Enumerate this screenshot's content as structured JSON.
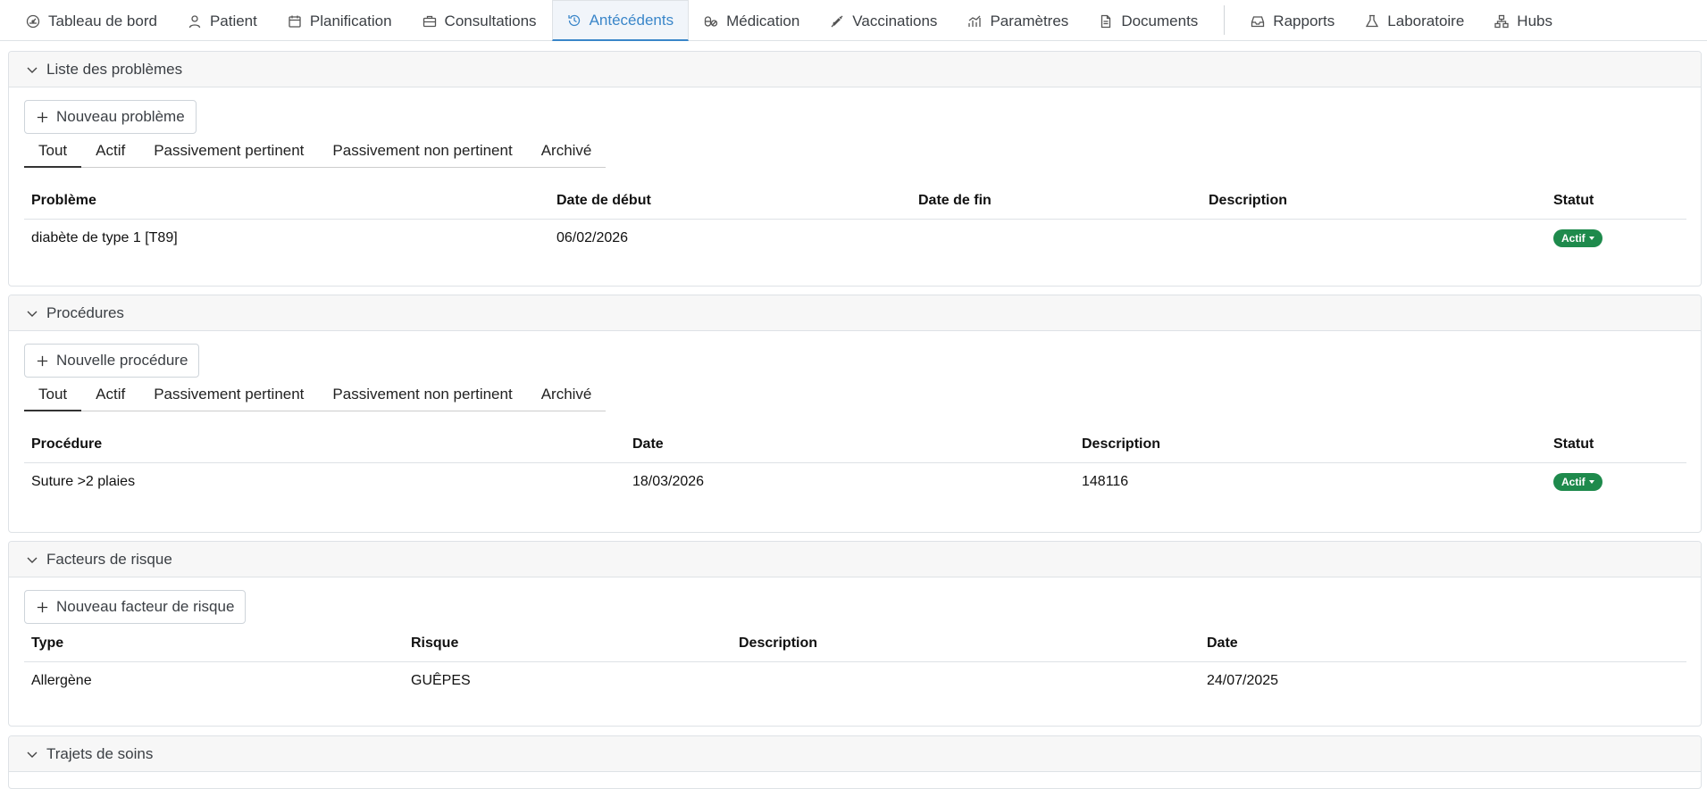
{
  "nav": {
    "tabs": [
      {
        "label": "Tableau de bord",
        "icon": "dashboard-icon"
      },
      {
        "label": "Patient",
        "icon": "user-icon"
      },
      {
        "label": "Planification",
        "icon": "calendar-icon"
      },
      {
        "label": "Consultations",
        "icon": "briefcase-icon"
      },
      {
        "label": "Antécédents",
        "icon": "history-icon",
        "active": true
      },
      {
        "label": "Médication",
        "icon": "pills-icon"
      },
      {
        "label": "Vaccinations",
        "icon": "syringe-icon"
      },
      {
        "label": "Paramètres",
        "icon": "chart-icon"
      },
      {
        "label": "Documents",
        "icon": "document-icon"
      },
      {
        "label": "Rapports",
        "icon": "inbox-icon"
      },
      {
        "label": "Laboratoire",
        "icon": "flask-icon"
      },
      {
        "label": "Hubs",
        "icon": "network-icon"
      }
    ]
  },
  "problems": {
    "title": "Liste des problèmes",
    "add_label": "Nouveau problème",
    "filters": [
      "Tout",
      "Actif",
      "Passivement pertinent",
      "Passivement non pertinent",
      "Archivé"
    ],
    "columns": [
      "Problème",
      "Date de début",
      "Date de fin",
      "Description",
      "Statut"
    ],
    "rows": [
      {
        "problem": "diabète de type 1 [T89]",
        "start": "06/02/2026",
        "end": "",
        "description": "",
        "status": "Actif"
      }
    ]
  },
  "procedures": {
    "title": "Procédures",
    "add_label": "Nouvelle procédure",
    "filters": [
      "Tout",
      "Actif",
      "Passivement pertinent",
      "Passivement non pertinent",
      "Archivé"
    ],
    "columns": [
      "Procédure",
      "Date",
      "Description",
      "Statut"
    ],
    "rows": [
      {
        "procedure": "Suture >2 plaies",
        "date": "18/03/2026",
        "description": "148116",
        "status": "Actif"
      }
    ]
  },
  "risk_factors": {
    "title": "Facteurs de risque",
    "add_label": "Nouveau facteur de risque",
    "columns": [
      "Type",
      "Risque",
      "Description",
      "Date"
    ],
    "rows": [
      {
        "type": "Allergène",
        "risk": "GUÊPES",
        "description": "",
        "date": "24/07/2025"
      }
    ]
  },
  "care_pathways": {
    "title": "Trajets de soins"
  },
  "colors": {
    "active_tab": "#3a86c9",
    "status_active": "#1e8a4c"
  }
}
